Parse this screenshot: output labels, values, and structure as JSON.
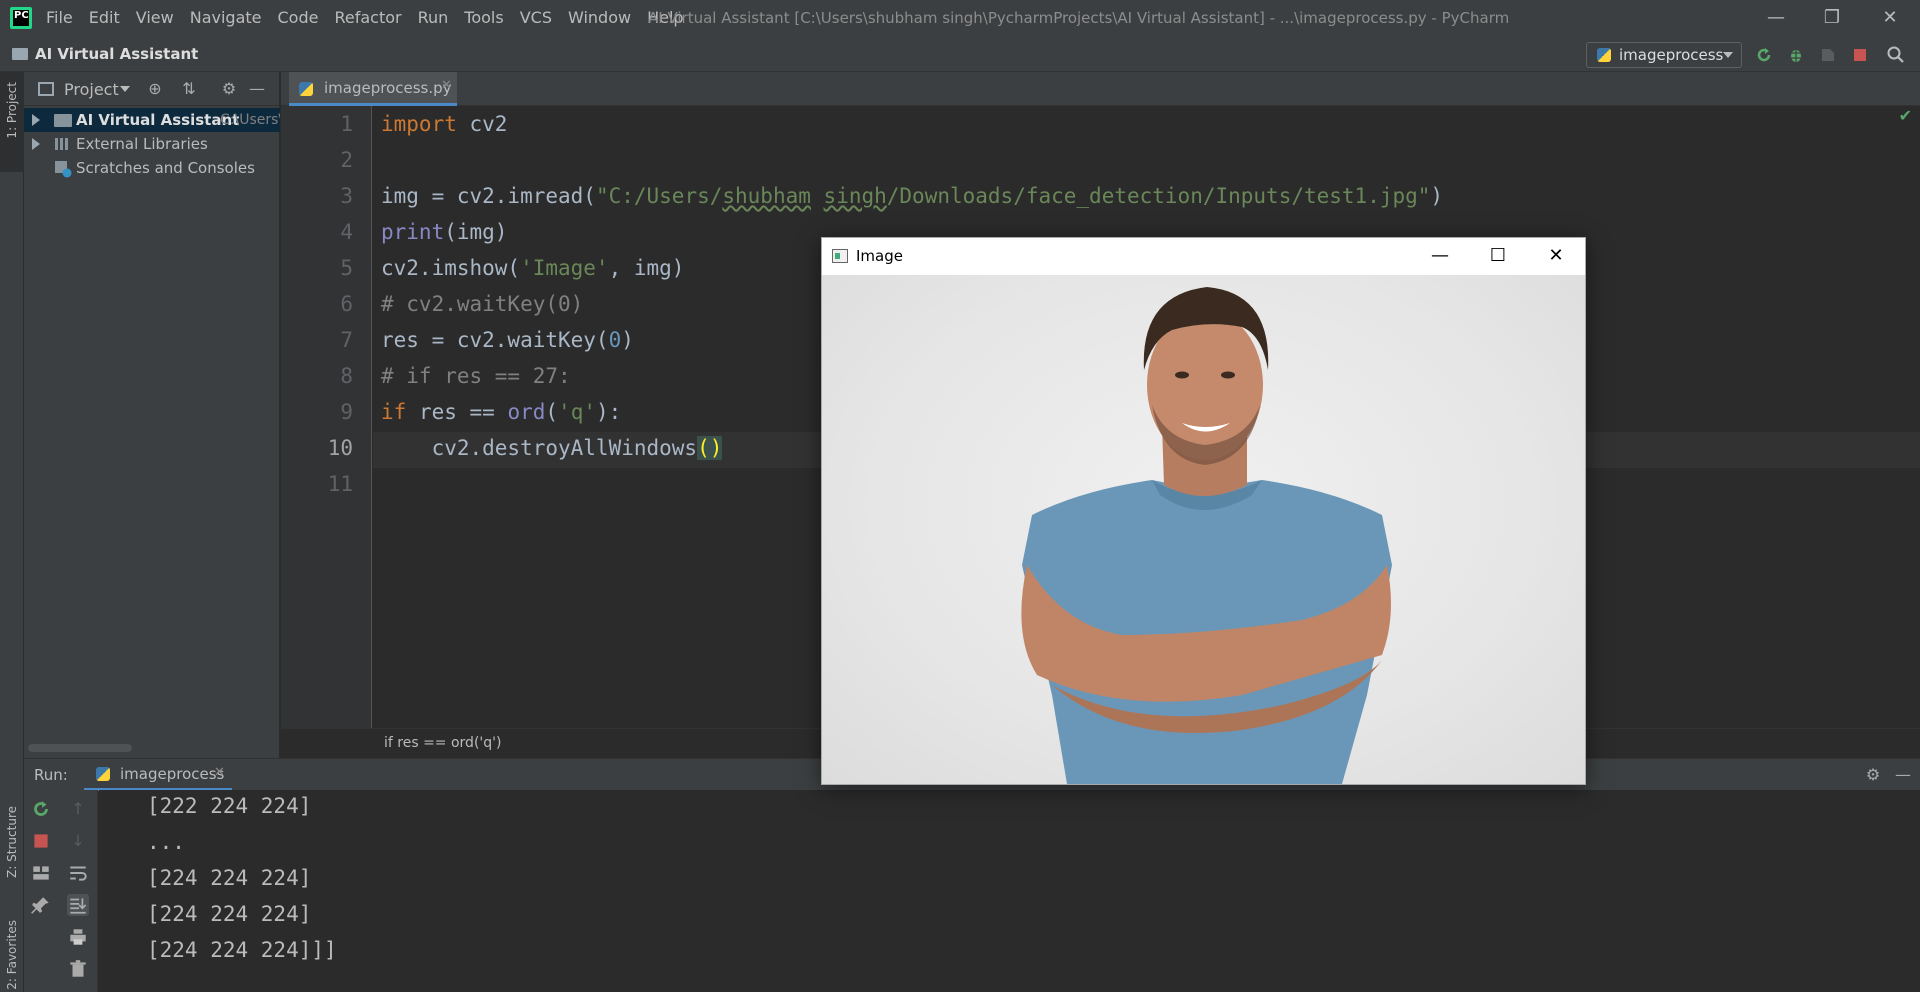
{
  "titlebar": {
    "menu": [
      "File",
      "Edit",
      "View",
      "Navigate",
      "Code",
      "Refactor",
      "Run",
      "Tools",
      "VCS",
      "Window",
      "Help"
    ],
    "window_title": "AI Virtual Assistant [C:\\Users\\shubham singh\\PycharmProjects\\AI Virtual Assistant] - ...\\imageprocess.py - PyCharm"
  },
  "navbar": {
    "project_name": "AI Virtual Assistant",
    "run_config": "imageprocess"
  },
  "left_strip": {
    "project_tab": "1: Project",
    "structure_tab": "Z: Structure",
    "favorites_tab": "2: Favorites"
  },
  "project_panel": {
    "title": "Project",
    "tree": [
      {
        "label": "AI Virtual Assistant",
        "path": "C:\\Users\\s"
      },
      {
        "label": "External Libraries"
      },
      {
        "label": "Scratches and Consoles"
      }
    ]
  },
  "editor": {
    "tab_label": "imageprocess.py",
    "line_numbers": [
      "1",
      "2",
      "3",
      "4",
      "5",
      "6",
      "7",
      "8",
      "9",
      "10",
      "11"
    ],
    "breadcrumb": "if res == ord('q')",
    "code": {
      "l1_kw": "import",
      "l1_rest": " cv2",
      "l3_a": "img = cv2.imread(",
      "l3_str1": "\"C:/Users/",
      "l3_sq1": "shubham",
      "l3_sp": " ",
      "l3_sq2": "singh",
      "l3_str2": "/Downloads/face_detection/Inputs/test1.jpg\"",
      "l3_b": ")",
      "l4_bi": "print",
      "l4_rest": "(img)",
      "l5_a": "cv2.imshow(",
      "l5_str": "'Image'",
      "l5_b": ", img)",
      "l6": "# cv2.waitKey(0)",
      "l7_a": "res = cv2.waitKey(",
      "l7_num": "0",
      "l7_b": ")",
      "l8": "# if res == 27:",
      "l9_kw": "if",
      "l9_a": " res == ",
      "l9_bi": "ord",
      "l9_b": "(",
      "l9_str": "'q'",
      "l9_c": "):",
      "l10_a": "    cv2.destroyAllWindows",
      "l10_paren": "()"
    }
  },
  "run_panel": {
    "label": "Run:",
    "tab_label": "imageprocess",
    "output": [
      "[222 224 224]",
      "...",
      "[224 224 224]",
      "[224 224 224]",
      "[224 224 224]]]"
    ]
  },
  "image_window": {
    "title": "Image"
  },
  "colors": {
    "accent": "#4a88c7",
    "keyword": "#cc7832",
    "string": "#6a8759",
    "number": "#6897bb",
    "builtin": "#8888c6",
    "comment": "#808080",
    "run_green": "#59a869",
    "stop_red": "#c75450"
  }
}
